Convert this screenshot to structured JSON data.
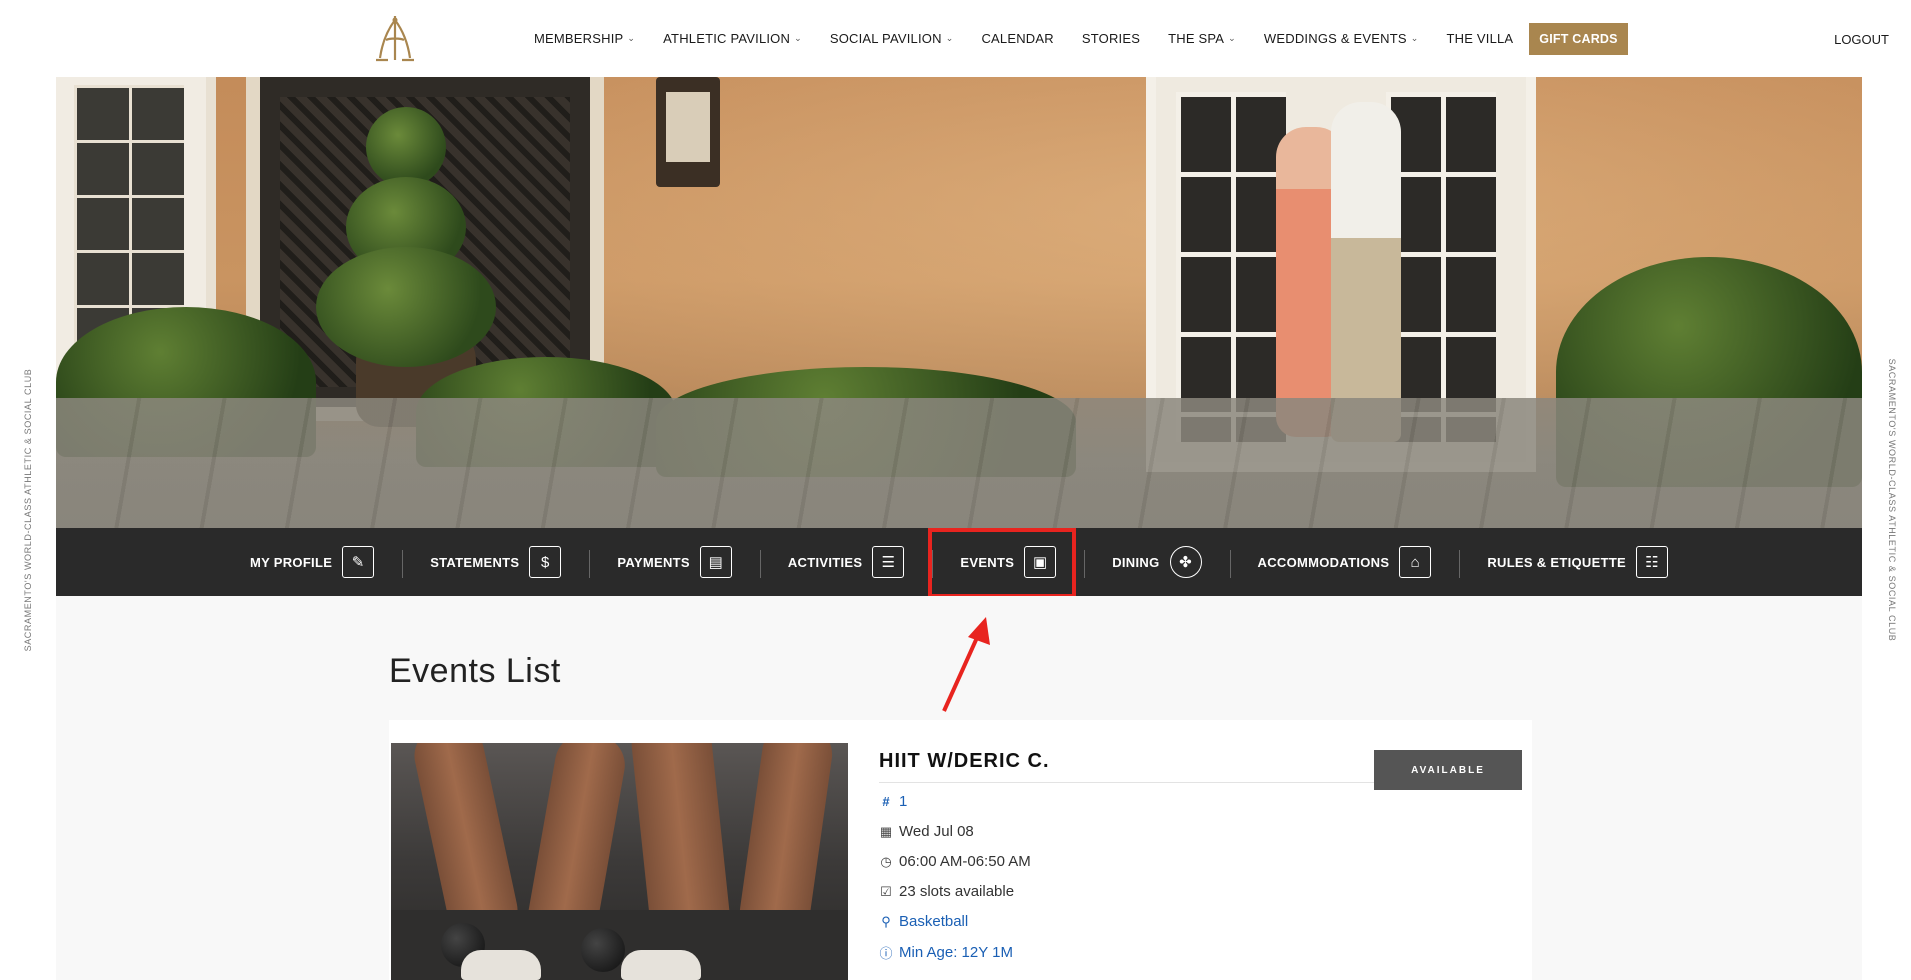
{
  "header": {
    "nav": [
      {
        "label": "MEMBERSHIP",
        "dropdown": true
      },
      {
        "label": "ATHLETIC PAVILION",
        "dropdown": true
      },
      {
        "label": "SOCIAL PAVILION",
        "dropdown": true
      },
      {
        "label": "CALENDAR",
        "dropdown": false
      },
      {
        "label": "STORIES",
        "dropdown": false
      },
      {
        "label": "THE SPA",
        "dropdown": true
      },
      {
        "label": "WEDDINGS & EVENTS",
        "dropdown": true
      },
      {
        "label": "THE VILLA",
        "dropdown": false
      }
    ],
    "gift_cards": "GIFT CARDS",
    "logout": "LOGOUT",
    "gift_color": "#a9864f"
  },
  "side_text": "SACRAMENTO'S WORLD-CLASS ATHLETIC & SOCIAL CLUB",
  "member_menu": [
    {
      "label": "MY PROFILE",
      "icon": "profile-icon"
    },
    {
      "label": "STATEMENTS",
      "icon": "statements-icon"
    },
    {
      "label": "PAYMENTS",
      "icon": "payments-icon"
    },
    {
      "label": "ACTIVITIES",
      "icon": "activities-icon"
    },
    {
      "label": "EVENTS",
      "icon": "calendar-icon"
    },
    {
      "label": "DINING",
      "icon": "dining-icon"
    },
    {
      "label": "ACCOMMODATIONS",
      "icon": "accommodations-icon"
    },
    {
      "label": "RULES & ETIQUETTE",
      "icon": "rules-icon"
    }
  ],
  "page_title": "Events List",
  "event": {
    "title": "HIIT W/DERIC C.",
    "status": "AVAILABLE",
    "number": "1",
    "date": "Wed Jul 08",
    "time": "06:00 AM-06:50 AM",
    "slots": "23 slots available",
    "location": "Basketball",
    "min_age": "Min Age: 12Y 1M"
  },
  "colors": {
    "member_bar": "#2a2a2a",
    "highlight": "#e8241f",
    "link": "#1a5fb4"
  }
}
